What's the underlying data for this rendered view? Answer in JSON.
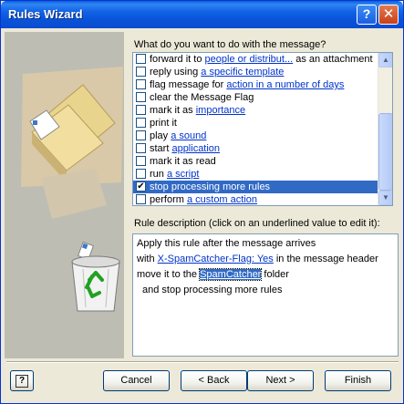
{
  "window": {
    "title": "Rules Wizard",
    "help_glyph": "?",
    "close_glyph": "✕"
  },
  "actions": {
    "question": "What do you want to do with the message?",
    "items": [
      {
        "pre": "forward it to ",
        "link": "people or distribut...",
        "post": " as an attachment",
        "checked": false,
        "selected": false
      },
      {
        "pre": "reply using ",
        "link": "a specific template",
        "post": "",
        "checked": false,
        "selected": false
      },
      {
        "pre": "flag message for ",
        "link": "action in a number of days",
        "post": "",
        "checked": false,
        "selected": false
      },
      {
        "pre": "clear the Message Flag",
        "link": "",
        "post": "",
        "checked": false,
        "selected": false
      },
      {
        "pre": "mark it as ",
        "link": "importance",
        "post": "",
        "checked": false,
        "selected": false
      },
      {
        "pre": "print it",
        "link": "",
        "post": "",
        "checked": false,
        "selected": false
      },
      {
        "pre": "play ",
        "link": "a sound",
        "post": "",
        "checked": false,
        "selected": false
      },
      {
        "pre": "start ",
        "link": "application",
        "post": "",
        "checked": false,
        "selected": false
      },
      {
        "pre": "mark it as read",
        "link": "",
        "post": "",
        "checked": false,
        "selected": false
      },
      {
        "pre": "run ",
        "link": "a script",
        "post": "",
        "checked": false,
        "selected": false
      },
      {
        "pre": "stop processing more rules",
        "link": "",
        "post": "",
        "checked": true,
        "selected": true
      },
      {
        "pre": "perform ",
        "link": "a custom action",
        "post": "",
        "checked": false,
        "selected": false
      }
    ],
    "scroll_up_glyph": "▲",
    "scroll_down_glyph": "▼"
  },
  "description": {
    "label": "Rule description (click on an underlined value to edit it):",
    "line1": "Apply this rule after the message arrives",
    "line2_pre": "with ",
    "line2_link": "X-SpamCatcher-Flag: Yes",
    "line2_post": " in the message header",
    "line3_pre": "move it to the ",
    "line3_link": "SpamCatcher",
    "line3_post": " folder",
    "line4": "and stop processing more rules"
  },
  "buttons": {
    "help": "?",
    "cancel": "Cancel",
    "back": "< Back",
    "next": "Next >",
    "finish": "Finish"
  },
  "icons": {
    "illustration": [
      "folder-icon",
      "envelope-icon",
      "recycle-bin-icon"
    ],
    "title_buttons": [
      "help-icon",
      "close-icon"
    ]
  },
  "colors": {
    "titlebar": "#0a5fdb",
    "selection": "#316ac5",
    "link": "#0033cc",
    "recycle": "#21a121"
  }
}
